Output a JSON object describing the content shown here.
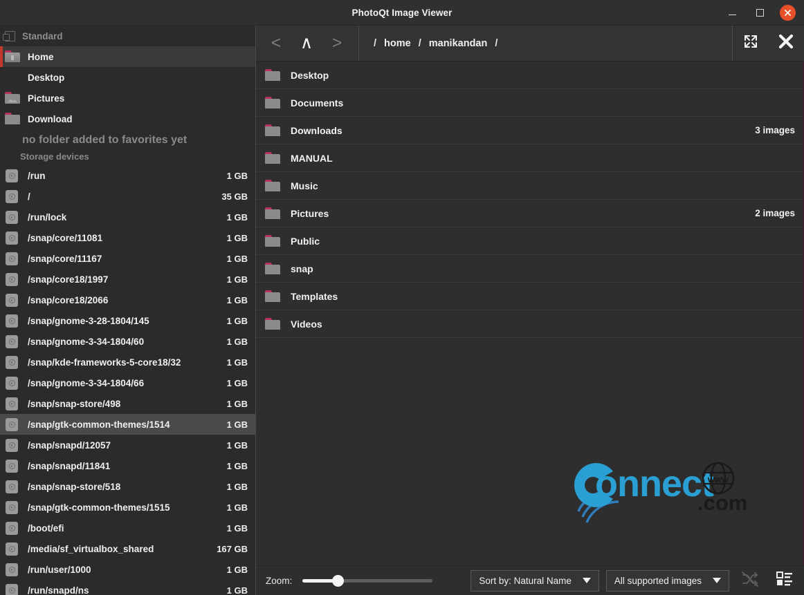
{
  "window": {
    "title": "PhotoQt Image Viewer",
    "minimize_label": "–",
    "maximize_label": "□",
    "close_label": "✕"
  },
  "sidebar": {
    "standard_header": "Standard",
    "standard_items": [
      {
        "label": "Home",
        "icon": "folder-home-icon",
        "active": true
      },
      {
        "label": "Desktop",
        "icon": "folder-desktop-icon",
        "active": false
      },
      {
        "label": "Pictures",
        "icon": "folder-pictures-icon",
        "active": false
      },
      {
        "label": "Download",
        "icon": "folder-download-icon",
        "active": false
      }
    ],
    "favorites_empty": "no folder added to favorites yet",
    "storage_header": "Storage devices",
    "devices": [
      {
        "label": "/run",
        "size": "1 GB"
      },
      {
        "label": "/",
        "size": "35 GB"
      },
      {
        "label": "/run/lock",
        "size": "1 GB"
      },
      {
        "label": "/snap/core/11081",
        "size": "1 GB"
      },
      {
        "label": "/snap/core/11167",
        "size": "1 GB"
      },
      {
        "label": "/snap/core18/1997",
        "size": "1 GB"
      },
      {
        "label": "/snap/core18/2066",
        "size": "1 GB"
      },
      {
        "label": "/snap/gnome-3-28-1804/145",
        "size": "1 GB"
      },
      {
        "label": "/snap/gnome-3-34-1804/60",
        "size": "1 GB"
      },
      {
        "label": "/snap/kde-frameworks-5-core18/32",
        "size": "1 GB"
      },
      {
        "label": "/snap/gnome-3-34-1804/66",
        "size": "1 GB"
      },
      {
        "label": "/snap/snap-store/498",
        "size": "1 GB"
      },
      {
        "label": "/snap/gtk-common-themes/1514",
        "size": "1 GB",
        "highlighted": true
      },
      {
        "label": "/snap/snapd/12057",
        "size": "1 GB"
      },
      {
        "label": "/snap/snapd/11841",
        "size": "1 GB"
      },
      {
        "label": "/snap/snap-store/518",
        "size": "1 GB"
      },
      {
        "label": "/snap/gtk-common-themes/1515",
        "size": "1 GB"
      },
      {
        "label": "/boot/efi",
        "size": "1 GB"
      },
      {
        "label": "/media/sf_virtualbox_shared",
        "size": "167 GB"
      },
      {
        "label": "/run/user/1000",
        "size": "1 GB"
      },
      {
        "label": "/run/snapd/ns",
        "size": "1 GB"
      }
    ]
  },
  "toolbar": {
    "back_label": "<",
    "up_label": "∧",
    "forward_label": ">",
    "breadcrumb": [
      "/",
      "home",
      "/",
      "manikandan",
      "/"
    ],
    "fullscreen_icon": "fullscreen-icon",
    "close_icon": "close-icon"
  },
  "files": [
    {
      "name": "Desktop",
      "count": ""
    },
    {
      "name": "Documents",
      "count": ""
    },
    {
      "name": "Downloads",
      "count": "3 images"
    },
    {
      "name": "MANUAL",
      "count": ""
    },
    {
      "name": "Music",
      "count": ""
    },
    {
      "name": "Pictures",
      "count": "2 images"
    },
    {
      "name": "Public",
      "count": ""
    },
    {
      "name": "snap",
      "count": ""
    },
    {
      "name": "Templates",
      "count": ""
    },
    {
      "name": "Videos",
      "count": ""
    }
  ],
  "watermark": {
    "brand": "Connect",
    "tld": ".com",
    "globe_text": "www"
  },
  "bottombar": {
    "zoom_label": "Zoom:",
    "zoom_value": "25",
    "sort_label": "Sort by: Natural Name",
    "filter_label": "All supported images",
    "shuffle_icon": "shuffle-disabled-icon",
    "viewmode_icon": "list-view-icon"
  },
  "colors": {
    "accent_red": "#c0392b",
    "close_orange": "#e8502a",
    "watermark_blue": "#2a9fd4",
    "bg_dark": "#2b2b2b",
    "bg_main": "#2e2e2e",
    "bg_toolbar": "#333333"
  }
}
